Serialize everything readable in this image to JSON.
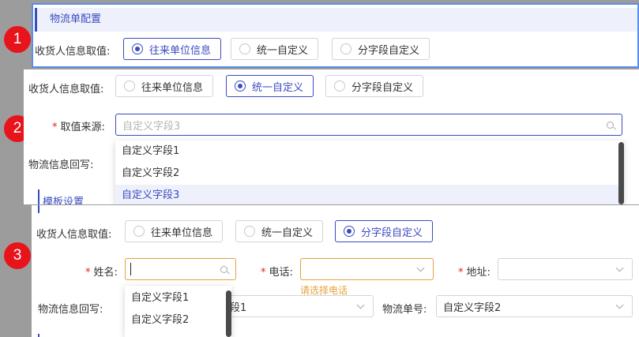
{
  "markers": [
    "1",
    "2",
    "3"
  ],
  "panel1": {
    "section_title": "物流单配置",
    "consignee_label": "收货人信息取值:",
    "options": [
      "往来单位信息",
      "统一自定义",
      "分字段自定义"
    ],
    "selected_index": 0
  },
  "panel2": {
    "consignee_label": "收货人信息取值:",
    "options": [
      "往来单位信息",
      "统一自定义",
      "分字段自定义"
    ],
    "selected_index": 1,
    "source_label": "取值来源:",
    "source_value": "自定义字段3",
    "writeback_label": "物流信息回写:",
    "section_title_partial": "模板设置",
    "dropdown_items": [
      "自定义字段1",
      "自定义字段2",
      "自定义字段3"
    ],
    "dropdown_selected": 2
  },
  "panel3": {
    "consignee_label": "收货人信息取值:",
    "options": [
      "往来单位信息",
      "统一自定义",
      "分字段自定义"
    ],
    "selected_index": 2,
    "name_label": "姓名:",
    "phone_label": "电话:",
    "phone_error": "请选择电话",
    "address_label": "地址:",
    "writeback_label": "物流信息回写:",
    "writeback_value_partial": "段1",
    "tracking_label": "物流单号:",
    "tracking_value": "自定义字段2",
    "dropdown_items": [
      "自定义字段1",
      "自定义字段2"
    ]
  },
  "colors": {
    "accent": "#3b4bc0",
    "required": "#e02020",
    "warning": "#e6a23c",
    "marker": "#e8141b"
  }
}
